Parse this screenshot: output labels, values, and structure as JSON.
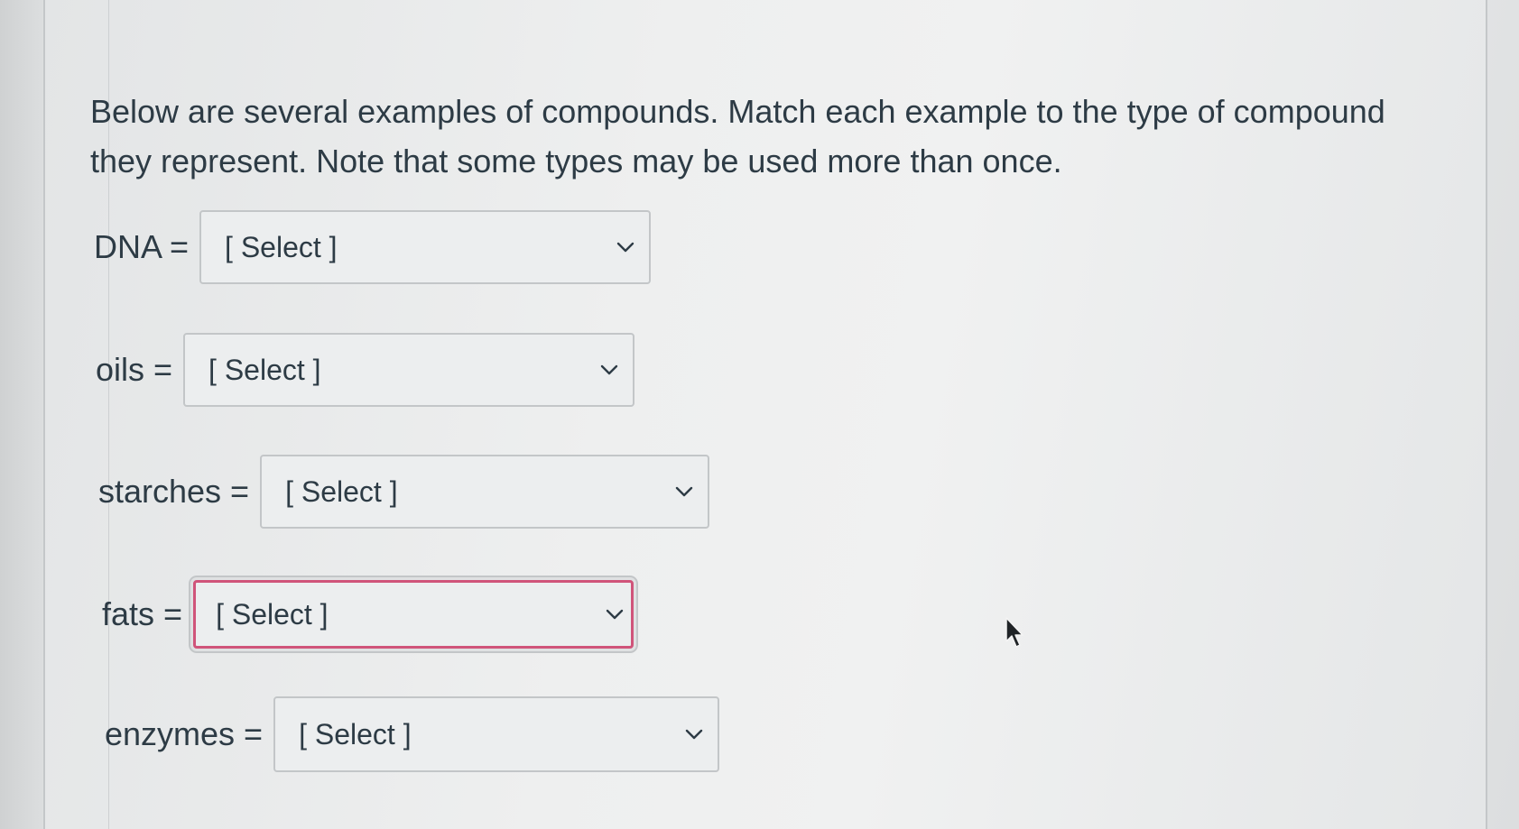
{
  "question": {
    "line1": "Below are several examples of compounds. Match each example to the type of compound",
    "line2": "they represent. Note that some types may be used more than once."
  },
  "matches": [
    {
      "label": "DNA =",
      "value": "[ Select ]"
    },
    {
      "label": "oils =",
      "value": "[ Select ]"
    },
    {
      "label": "starches =",
      "value": "[ Select ]"
    },
    {
      "label": "fats =",
      "value": "[ Select ]"
    },
    {
      "label": "enzymes =",
      "value": "[ Select ]"
    }
  ],
  "icons": {
    "dropdown": "chevron-down-icon",
    "pointer": "mouse-cursor-icon"
  },
  "colors": {
    "text": "#2d3b45",
    "focus_border": "#d0547a",
    "select_border": "#c3c6c8"
  }
}
